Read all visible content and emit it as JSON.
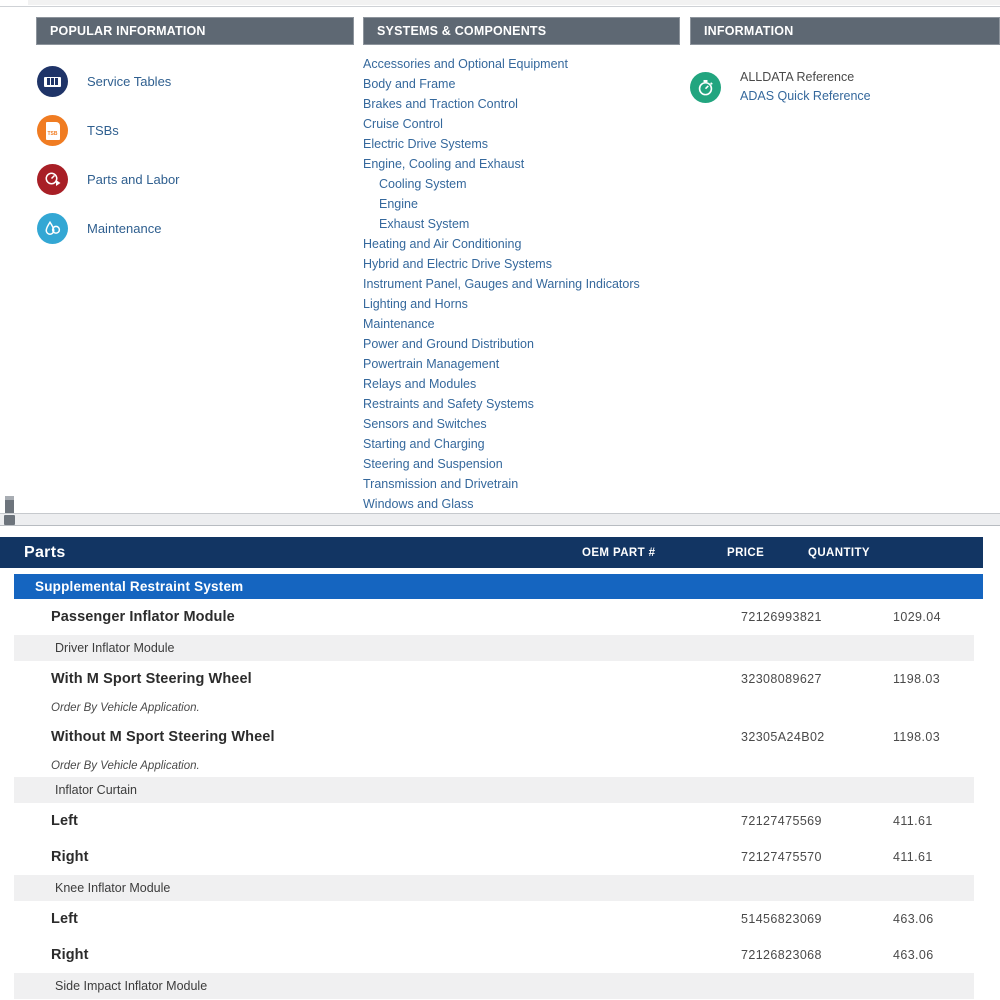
{
  "panels": {
    "popular": {
      "header": "POPULAR INFORMATION",
      "items": [
        {
          "label": "Service Tables",
          "icon": "odometer-icon"
        },
        {
          "label": "TSBs",
          "icon": "document-icon"
        },
        {
          "label": "Parts and Labor",
          "icon": "gauge-icon"
        },
        {
          "label": "Maintenance",
          "icon": "oil-drop-icon"
        }
      ]
    },
    "systems": {
      "header": "SYSTEMS & COMPONENTS",
      "items": [
        {
          "label": "Accessories and Optional Equipment",
          "sub": false
        },
        {
          "label": "Body and Frame",
          "sub": false
        },
        {
          "label": "Brakes and Traction Control",
          "sub": false
        },
        {
          "label": "Cruise Control",
          "sub": false
        },
        {
          "label": "Electric Drive Systems",
          "sub": false
        },
        {
          "label": "Engine, Cooling and Exhaust",
          "sub": false
        },
        {
          "label": "Cooling System",
          "sub": true
        },
        {
          "label": "Engine",
          "sub": true
        },
        {
          "label": "Exhaust System",
          "sub": true
        },
        {
          "label": "Heating and Air Conditioning",
          "sub": false
        },
        {
          "label": "Hybrid and Electric Drive Systems",
          "sub": false
        },
        {
          "label": "Instrument Panel, Gauges and Warning Indicators",
          "sub": false
        },
        {
          "label": "Lighting and Horns",
          "sub": false
        },
        {
          "label": "Maintenance",
          "sub": false
        },
        {
          "label": "Power and Ground Distribution",
          "sub": false
        },
        {
          "label": "Powertrain Management",
          "sub": false
        },
        {
          "label": "Relays and Modules",
          "sub": false
        },
        {
          "label": "Restraints and Safety Systems",
          "sub": false
        },
        {
          "label": "Sensors and Switches",
          "sub": false
        },
        {
          "label": "Starting and Charging",
          "sub": false
        },
        {
          "label": "Steering and Suspension",
          "sub": false
        },
        {
          "label": "Transmission and Drivetrain",
          "sub": false
        },
        {
          "label": "Windows and Glass",
          "sub": false
        }
      ]
    },
    "information": {
      "header": "INFORMATION",
      "icon": "stopwatch-icon",
      "links": [
        {
          "label": "ALLDATA Reference",
          "style": "plain"
        },
        {
          "label": "ADAS Quick Reference",
          "style": "link"
        }
      ]
    }
  },
  "parts": {
    "title": "Parts",
    "columns": {
      "oem": "OEM PART #",
      "price": "PRICE",
      "quantity": "QUANTITY"
    },
    "rows": [
      {
        "type": "group",
        "label": "Supplemental Restraint System"
      },
      {
        "type": "part",
        "label": "Passenger Inflator Module",
        "oem": "72126993821",
        "price": "1029.04",
        "quantity": ""
      },
      {
        "type": "sub",
        "label": "Driver Inflator Module"
      },
      {
        "type": "part",
        "label": "With M Sport Steering Wheel",
        "oem": "32308089627",
        "price": "1198.03",
        "quantity": ""
      },
      {
        "type": "note",
        "label": "Order By Vehicle Application."
      },
      {
        "type": "part",
        "label": "Without M Sport Steering Wheel",
        "oem": "32305A24B02",
        "price": "1198.03",
        "quantity": ""
      },
      {
        "type": "note",
        "label": "Order By Vehicle Application."
      },
      {
        "type": "sub",
        "label": "Inflator Curtain"
      },
      {
        "type": "part",
        "label": "Left",
        "oem": "72127475569",
        "price": "411.61",
        "quantity": ""
      },
      {
        "type": "part",
        "label": "Right",
        "oem": "72127475570",
        "price": "411.61",
        "quantity": ""
      },
      {
        "type": "sub",
        "label": "Knee Inflator Module"
      },
      {
        "type": "part",
        "label": "Left",
        "oem": "51456823069",
        "price": "463.06",
        "quantity": ""
      },
      {
        "type": "part",
        "label": "Right",
        "oem": "72126823068",
        "price": "463.06",
        "quantity": ""
      },
      {
        "type": "sub",
        "label": "Side Impact Inflator Module"
      }
    ]
  },
  "colors": {
    "panel_header": "#5e6873",
    "table_header": "#123563",
    "group_row": "#1565c0",
    "link": "#35689c",
    "icon_service": "#1f3468",
    "icon_tsb": "#f07c22",
    "icon_parts": "#a81f26",
    "icon_maint": "#33a7d4",
    "icon_info": "#22a57f"
  }
}
